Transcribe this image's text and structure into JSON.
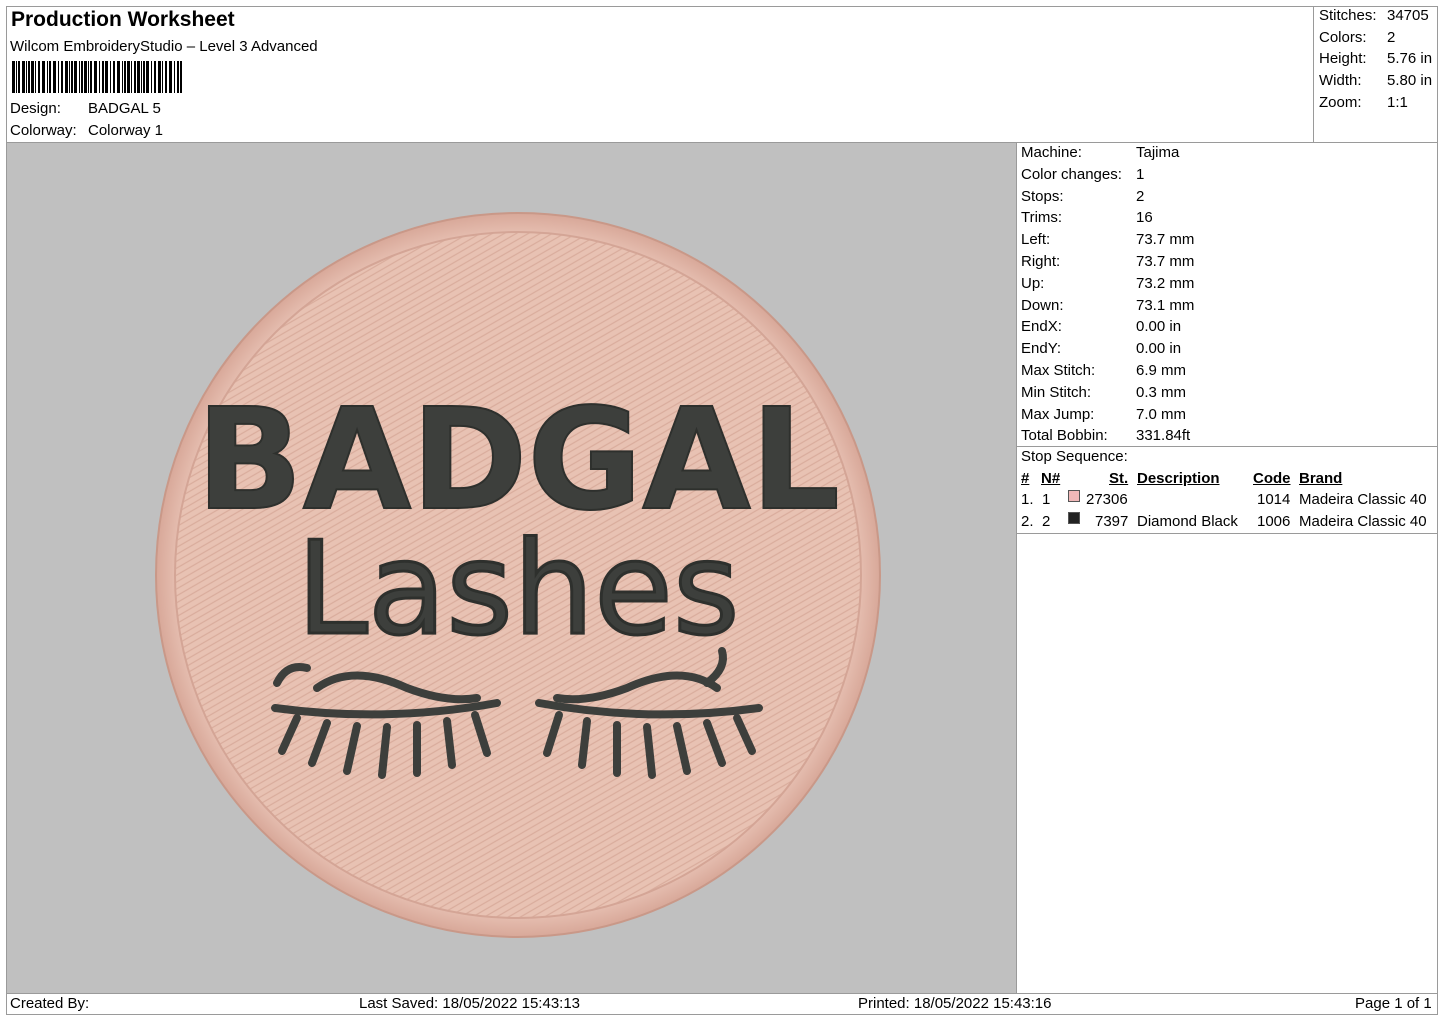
{
  "header": {
    "title": "Production Worksheet",
    "software": "Wilcom EmbroideryStudio – Level 3 Advanced",
    "design_label": "Design:",
    "design_value": "BADGAL 5",
    "colorway_label": "Colorway:",
    "colorway_value": "Colorway 1"
  },
  "summary": {
    "stitches_label": "Stitches:",
    "stitches_value": "34705",
    "colors_label": "Colors:",
    "colors_value": "2",
    "height_label": "Height:",
    "height_value": "5.76 in",
    "width_label": "Width:",
    "width_value": "5.80 in",
    "zoom_label": "Zoom:",
    "zoom_value": "1:1"
  },
  "machine_info": [
    {
      "label": "Machine:",
      "value": "Tajima"
    },
    {
      "label": "Color changes:",
      "value": "1"
    },
    {
      "label": "Stops:",
      "value": "2"
    },
    {
      "label": "Trims:",
      "value": "16"
    },
    {
      "label": "Left:",
      "value": "73.7 mm"
    },
    {
      "label": "Right:",
      "value": "73.7 mm"
    },
    {
      "label": "Up:",
      "value": "73.2 mm"
    },
    {
      "label": "Down:",
      "value": "73.1 mm"
    },
    {
      "label": "EndX:",
      "value": "0.00 in"
    },
    {
      "label": "EndY:",
      "value": "0.00 in"
    },
    {
      "label": "Max Stitch:",
      "value": "6.9 mm"
    },
    {
      "label": "Min Stitch:",
      "value": "0.3 mm"
    },
    {
      "label": "Max Jump:",
      "value": "7.0 mm"
    },
    {
      "label": "Total Bobbin:",
      "value": "331.84ft"
    }
  ],
  "stop_sequence": {
    "title": "Stop Sequence:",
    "headers": {
      "index": "#",
      "needle": "N#",
      "stitches": "St.",
      "description": "Description",
      "code": "Code",
      "brand": "Brand"
    },
    "rows": [
      {
        "index": "1.",
        "needle": "1",
        "color": "#f0b8b8",
        "stitches": "27306",
        "description": "",
        "code": "1014",
        "brand": "Madeira Classic 40"
      },
      {
        "index": "2.",
        "needle": "2",
        "color": "#222222",
        "stitches": "7397",
        "description": "Diamond Black",
        "code": "1006",
        "brand": "Madeira Classic 40"
      }
    ]
  },
  "design_preview": {
    "line1": "BADGAL",
    "line2": "Lashes",
    "fill_color": "#e9c3b5",
    "thread_dark": "#3d3f3c",
    "background": "#c0c0c0"
  },
  "footer": {
    "created_by": "Created By:",
    "last_saved": "Last Saved: 18/05/2022 15:43:13",
    "printed": "Printed: 18/05/2022 15:43:16",
    "page": "Page 1 of 1"
  }
}
